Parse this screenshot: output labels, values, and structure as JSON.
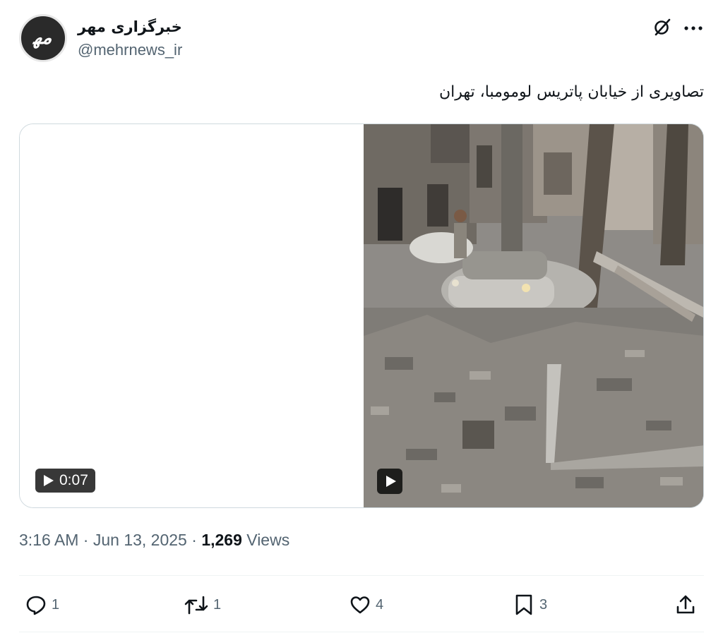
{
  "author": {
    "display_name": "خبرگزاری مهر",
    "handle": "@mehrnews_ir",
    "avatar_icon": "mehr-logo-icon"
  },
  "header_icons": {
    "grok": "grok-icon",
    "more": "more-icon"
  },
  "tweet": {
    "text": "تصاویری از خیابان پاتریس لومومبا، تهران"
  },
  "media": {
    "video_1_duration": "0:07",
    "play_icon": "play-icon"
  },
  "meta": {
    "time": "3:16 AM",
    "separator": "·",
    "date": "Jun 13, 2025",
    "views_count": "1,269",
    "views_label": "Views"
  },
  "actions": {
    "replies": "1",
    "reposts": "1",
    "likes": "4",
    "bookmarks": "3"
  },
  "colors": {
    "text_primary": "#0f1419",
    "text_secondary": "#536471",
    "border": "#cfd9de",
    "divider": "#eff3f4"
  }
}
